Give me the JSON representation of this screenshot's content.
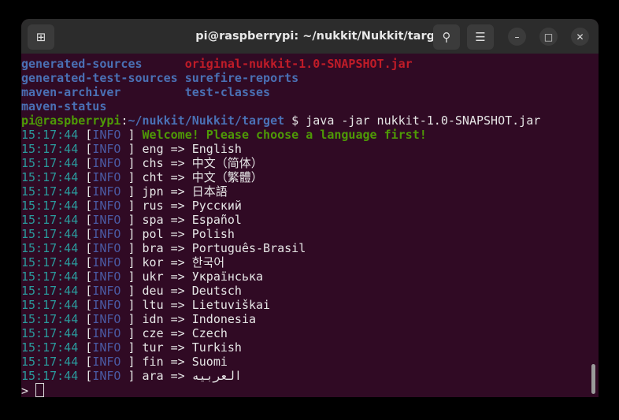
{
  "window": {
    "title": "pi@raspberrypi: ~/nukkit/Nukkit/target",
    "icons": [
      "new-tab-icon",
      "search-icon",
      "menu-icon",
      "minimize-icon",
      "maximize-icon",
      "close-icon"
    ],
    "glyphs": {
      "new_tab": "⊞",
      "search": "⚲",
      "menu": "☰",
      "minimize": "–",
      "maximize": "□",
      "close": "✕"
    }
  },
  "ls": [
    [
      "generated-sources      ",
      "original-nukkit-1.0-SNAPSHOT.jar"
    ],
    [
      "generated-test-sources ",
      "surefire-reports"
    ],
    [
      "maven-archiver         ",
      "test-classes"
    ],
    [
      "maven-status",
      ""
    ]
  ],
  "prompt": {
    "user": "pi@raspberrypi",
    "sep": ":",
    "path": "~/nukkit/Nukkit/target",
    "symbol": " $ ",
    "command": "java -jar nukkit-1.0-SNAPSHOT.jar"
  },
  "log_time": "15:17:44",
  "log_level": "INFO",
  "welcome": "Welcome! Please choose a language first!",
  "languages": [
    {
      "code": "eng",
      "name": "English"
    },
    {
      "code": "chs",
      "name": "中文（简体）"
    },
    {
      "code": "cht",
      "name": "中文（繁體）"
    },
    {
      "code": "jpn",
      "name": "日本語"
    },
    {
      "code": "rus",
      "name": "Русский"
    },
    {
      "code": "spa",
      "name": "Español"
    },
    {
      "code": "pol",
      "name": "Polish"
    },
    {
      "code": "bra",
      "name": "Português-Brasil"
    },
    {
      "code": "kor",
      "name": "한국어"
    },
    {
      "code": "ukr",
      "name": "Українська"
    },
    {
      "code": "deu",
      "name": "Deutsch"
    },
    {
      "code": "ltu",
      "name": "Lietuviškai"
    },
    {
      "code": "idn",
      "name": "Indonesia"
    },
    {
      "code": "cze",
      "name": "Czech"
    },
    {
      "code": "tur",
      "name": "Turkish"
    },
    {
      "code": "fin",
      "name": "Suomi"
    },
    {
      "code": "ara",
      "name": "العربيه"
    }
  ],
  "input_prompt": "> "
}
